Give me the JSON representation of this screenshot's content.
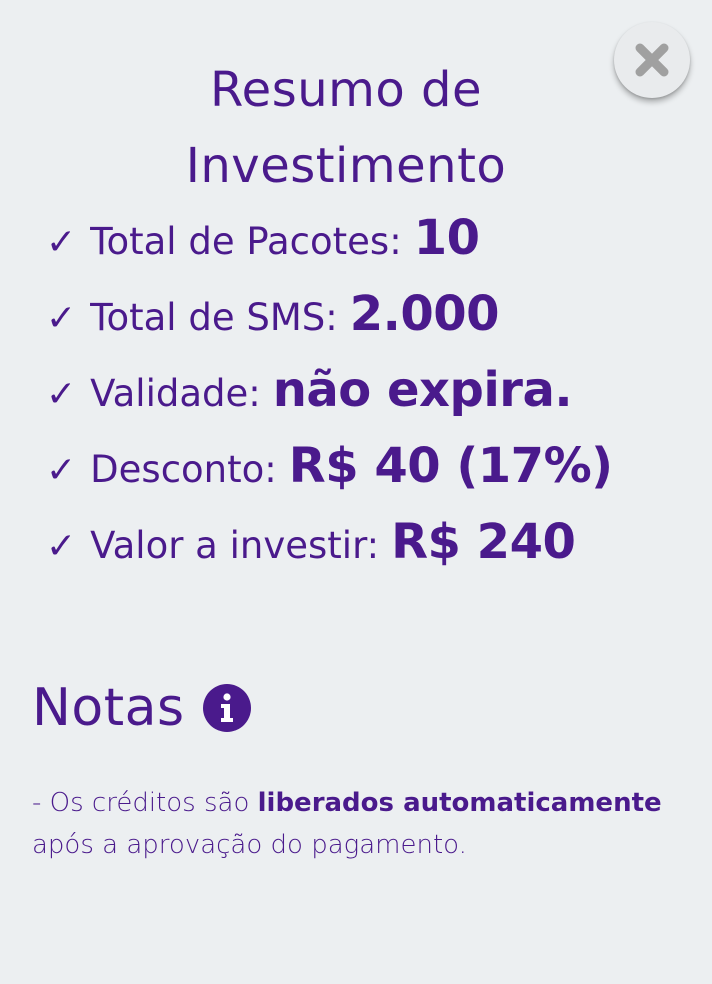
{
  "close_button": {
    "icon": "close-icon"
  },
  "title": {
    "line1": "Resumo de",
    "line2": "Investimento"
  },
  "summary": {
    "check_glyph": "✓",
    "items": [
      {
        "label": "Total de Pacotes:",
        "value": "10"
      },
      {
        "label": "Total de SMS:",
        "value": "2.000"
      },
      {
        "label": "Validade:",
        "value": "não expira."
      },
      {
        "label": "Desconto:",
        "value": "R$ 40 (17%)"
      },
      {
        "label": "Valor a investir:",
        "value": "R$ 240"
      }
    ]
  },
  "notes": {
    "title": "Notas",
    "icon": "info-icon",
    "text_before": "- Os créditos são ",
    "text_bold": "liberados automaticamente",
    "text_after": " após a aprovação do pagamento."
  },
  "colors": {
    "primary": "#4a1a8c",
    "background": "#eceff1",
    "close_icon": "#9e9e9e"
  }
}
